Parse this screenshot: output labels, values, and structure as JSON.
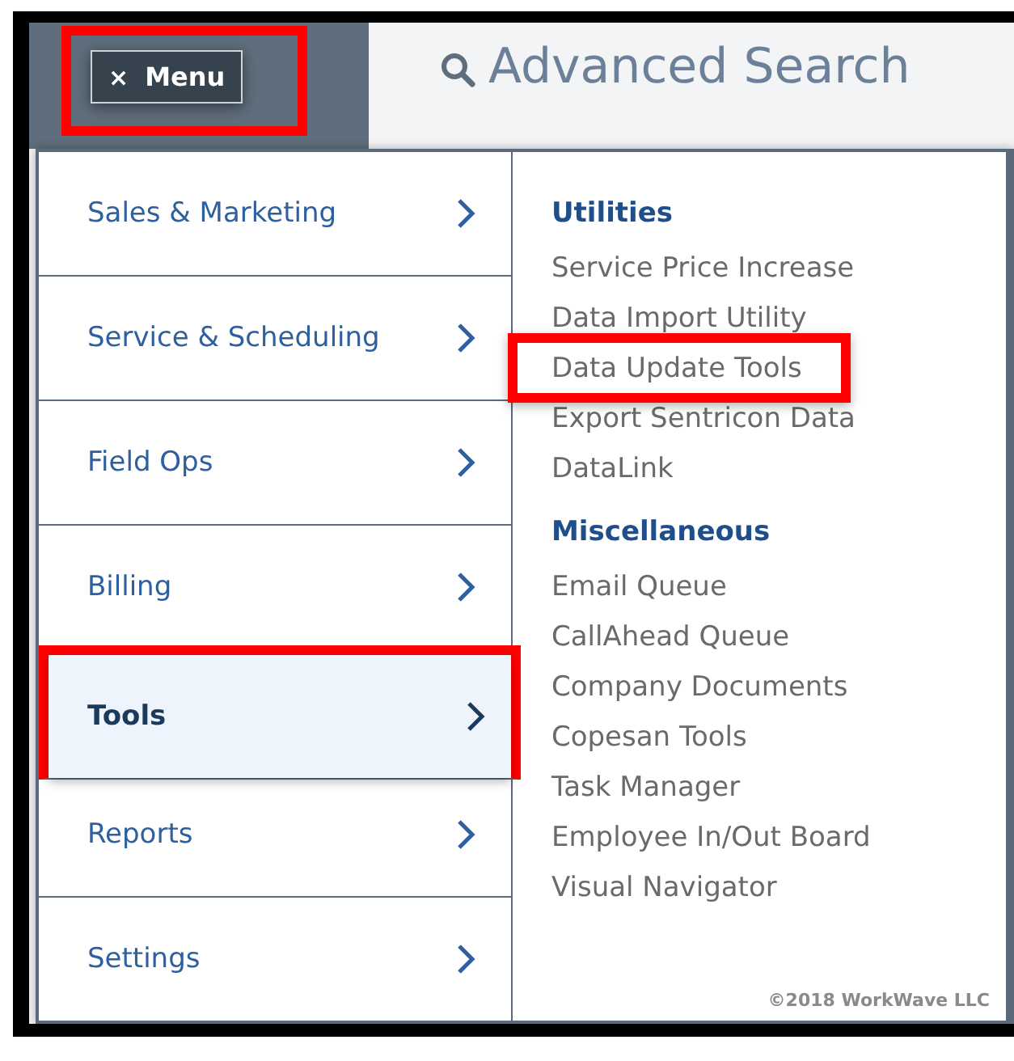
{
  "header": {
    "menu_button": {
      "icon": "×",
      "label": "Menu",
      "highlighted": true
    },
    "title": "Advanced Search"
  },
  "menu": {
    "categories": [
      {
        "label": "Sales & Marketing",
        "selected": false,
        "highlighted": false
      },
      {
        "label": "Service & Scheduling",
        "selected": false,
        "highlighted": false
      },
      {
        "label": "Field Ops",
        "selected": false,
        "highlighted": false
      },
      {
        "label": "Billing",
        "selected": false,
        "highlighted": false
      },
      {
        "label": "Tools",
        "selected": true,
        "highlighted": true
      },
      {
        "label": "Reports",
        "selected": false,
        "highlighted": false
      },
      {
        "label": "Settings",
        "selected": false,
        "highlighted": false
      }
    ],
    "sections": [
      {
        "heading": "Utilities",
        "links": [
          {
            "label": "Service Price Increase",
            "highlighted": false
          },
          {
            "label": "Data Import Utility",
            "highlighted": false
          },
          {
            "label": "Data Update Tools",
            "highlighted": true
          },
          {
            "label": "Export Sentricon Data",
            "highlighted": false
          },
          {
            "label": "DataLink",
            "highlighted": false
          }
        ]
      },
      {
        "heading": "Miscellaneous",
        "links": [
          {
            "label": "Email Queue",
            "highlighted": false
          },
          {
            "label": "CallAhead Queue",
            "highlighted": false
          },
          {
            "label": "Company Documents",
            "highlighted": false
          },
          {
            "label": "Copesan Tools",
            "highlighted": false
          },
          {
            "label": "Task Manager",
            "highlighted": false
          },
          {
            "label": "Employee In/Out Board",
            "highlighted": false
          },
          {
            "label": "Visual Navigator",
            "highlighted": false
          }
        ]
      }
    ],
    "copyright": "©2018 WorkWave LLC"
  }
}
